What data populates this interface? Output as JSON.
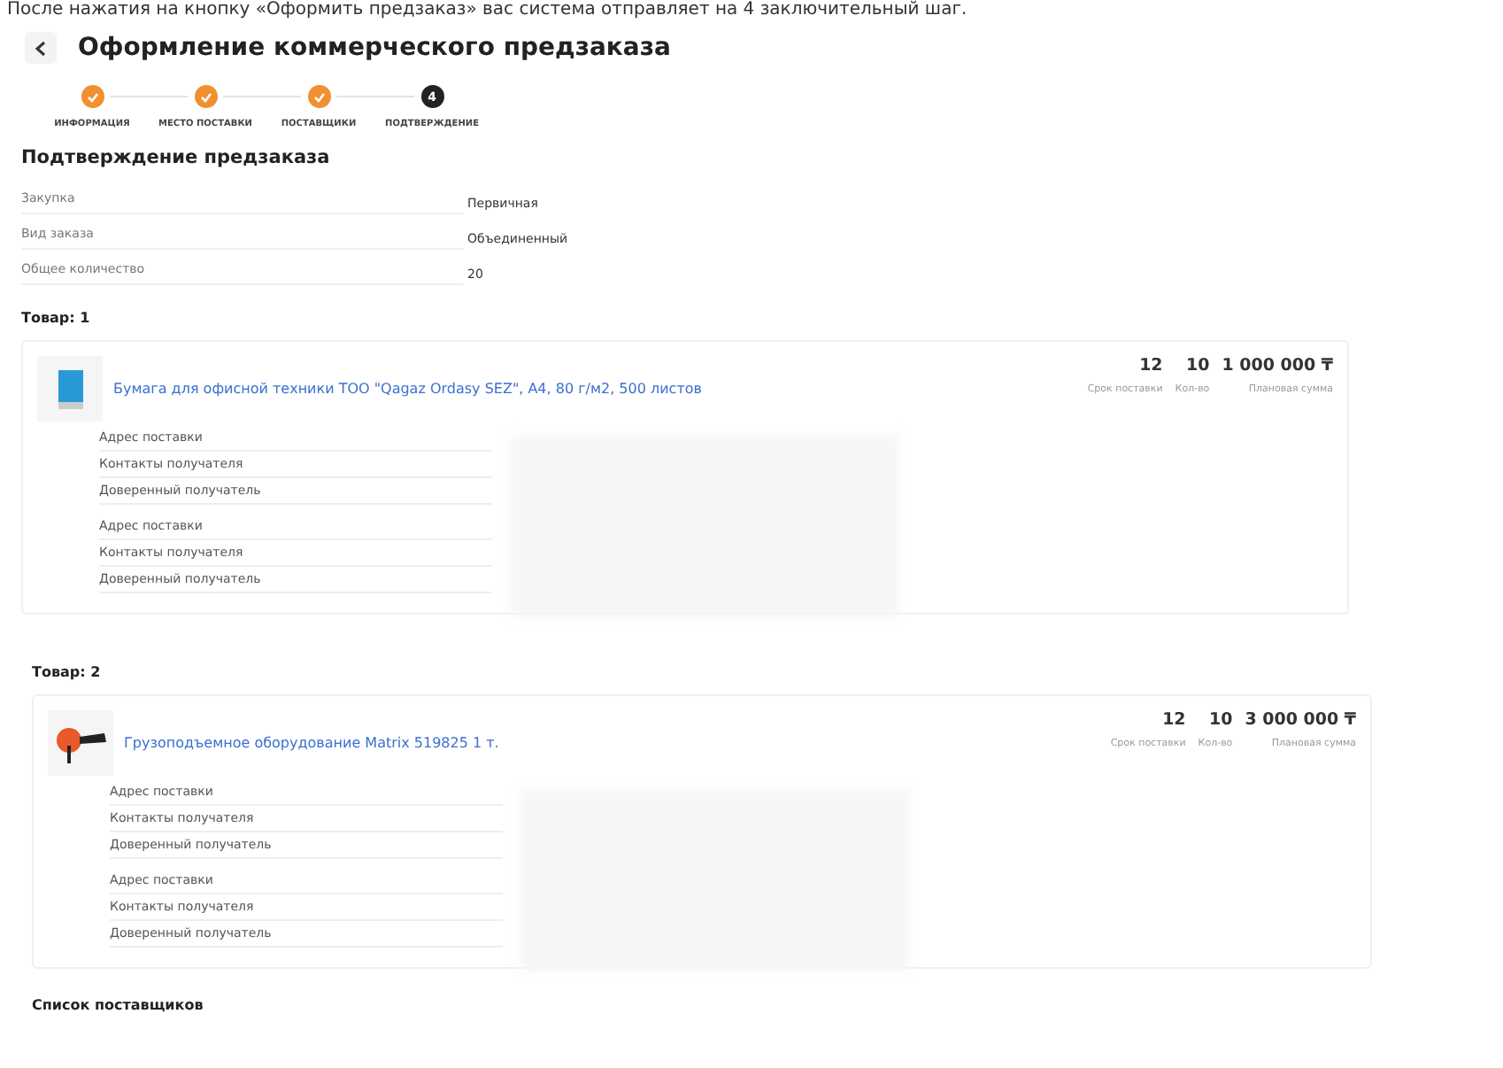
{
  "caption": "После нажатия на кнопку «Оформить предзаказ» вас система отправляет на 4 заключительный шаг.",
  "page": {
    "title": "Оформление коммерческого предзаказа"
  },
  "steps": [
    {
      "label": "ИНФОРМАЦИЯ",
      "done": true
    },
    {
      "label": "МЕСТО ПОСТАВКИ",
      "done": true
    },
    {
      "label": "ПОСТАВЩИКИ",
      "done": true
    },
    {
      "label": "ПОДТВЕРЖДЕНИЕ",
      "done": false,
      "number": "4"
    }
  ],
  "section_title": "Подтверждение предзаказа",
  "summary": [
    {
      "label": "Закупка",
      "value": "Первичная"
    },
    {
      "label": "Вид заказа",
      "value": "Объединенный"
    },
    {
      "label": "Общее количество",
      "value": "20"
    }
  ],
  "products": [
    {
      "heading": "Товар: 1",
      "kind": "paper",
      "name": "Бумага для офисной техники ТОО \"Qagaz Ordasy SEZ\", A4, 80 г/м2, 500 листов",
      "term": "12",
      "term_label": "Срок поставки",
      "qty": "10",
      "qty_label": "Кол-во",
      "sum": "1 000 000 ₸",
      "sum_label": "Плановая сумма",
      "details": [
        [
          "Адрес поставки",
          "Контакты получателя",
          "Доверенный получатель"
        ],
        [
          "Адрес поставки",
          "Контакты получателя",
          "Доверенный получатель"
        ]
      ]
    },
    {
      "heading": "Товар: 2",
      "kind": "hoist",
      "name": "Грузоподъемное оборудование Matrix 519825 1 т.",
      "term": "12",
      "term_label": "Срок поставки",
      "qty": "10",
      "qty_label": "Кол-во",
      "sum": "3 000 000 ₸",
      "sum_label": "Плановая сумма",
      "details": [
        [
          "Адрес поставки",
          "Контакты получателя",
          "Доверенный получатель"
        ],
        [
          "Адрес поставки",
          "Контакты получателя",
          "Доверенный получатель"
        ]
      ]
    }
  ],
  "suppliers_title": "Список поставщиков"
}
